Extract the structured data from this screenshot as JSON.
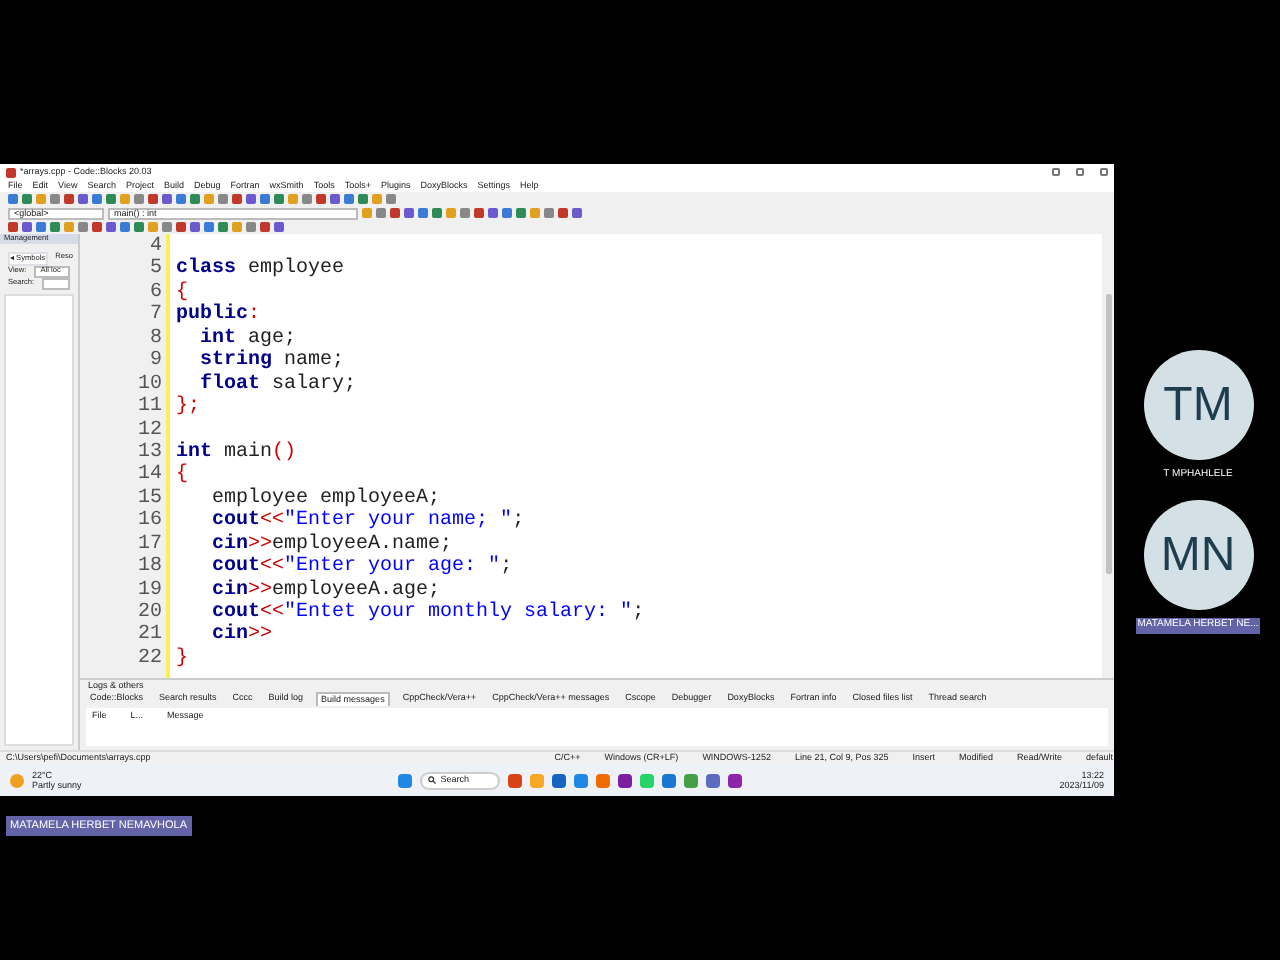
{
  "window": {
    "title": "*arrays.cpp - Code::Blocks 20.03"
  },
  "menu": [
    "File",
    "Edit",
    "View",
    "Search",
    "Project",
    "Build",
    "Debug",
    "Fortran",
    "wxSmith",
    "Tools",
    "Tools+",
    "Plugins",
    "DoxyBlocks",
    "Settings",
    "Help"
  ],
  "scope": {
    "scope_field": "<global>",
    "function_field": "main() : int"
  },
  "management": {
    "title": "Management",
    "tabs": [
      {
        "label": "◂ Symbols",
        "selected": true
      },
      {
        "label": "Reso",
        "selected": false
      }
    ],
    "view_label": "View:",
    "view_value": "All loc",
    "search_label": "Search:"
  },
  "editor": {
    "lines": [
      {
        "number": "4"
      },
      {
        "number": "5",
        "tokens": [
          {
            "kind": "keyword",
            "text": "class"
          },
          {
            "kind": "plain",
            "text": " employee"
          }
        ]
      },
      {
        "number": "6",
        "tokens": [
          {
            "kind": "op",
            "text": "{"
          }
        ]
      },
      {
        "number": "7",
        "tokens": [
          {
            "kind": "keyword",
            "text": "public"
          },
          {
            "kind": "op",
            "text": ":"
          }
        ]
      },
      {
        "number": "8",
        "tokens": [
          {
            "kind": "keyword",
            "text": "  int"
          },
          {
            "kind": "plain",
            "text": " age;"
          }
        ]
      },
      {
        "number": "9",
        "tokens": [
          {
            "kind": "keyword",
            "text": "  string"
          },
          {
            "kind": "plain",
            "text": " name;"
          }
        ]
      },
      {
        "number": "10",
        "tokens": [
          {
            "kind": "keyword",
            "text": "  float"
          },
          {
            "kind": "plain",
            "text": " salary;"
          }
        ]
      },
      {
        "number": "11",
        "tokens": [
          {
            "kind": "op",
            "text": "};"
          }
        ]
      },
      {
        "number": "12"
      },
      {
        "number": "13",
        "tokens": [
          {
            "kind": "keyword",
            "text": "int"
          },
          {
            "kind": "plain",
            "text": " main"
          },
          {
            "kind": "op",
            "text": "()"
          }
        ]
      },
      {
        "number": "14",
        "tokens": [
          {
            "kind": "op",
            "text": "{"
          }
        ]
      },
      {
        "number": "15",
        "tokens": [
          {
            "kind": "plain",
            "text": "   employee employeeA;"
          }
        ]
      },
      {
        "number": "16",
        "tokens": [
          {
            "kind": "keyword",
            "text": "   cout"
          },
          {
            "kind": "op",
            "text": "<<"
          },
          {
            "kind": "string",
            "text": "\"Enter your name; \""
          },
          {
            "kind": "plain",
            "text": ";"
          }
        ]
      },
      {
        "number": "17",
        "tokens": [
          {
            "kind": "keyword",
            "text": "   cin"
          },
          {
            "kind": "op",
            "text": ">>"
          },
          {
            "kind": "plain",
            "text": "employeeA.name;"
          }
        ]
      },
      {
        "number": "18",
        "tokens": [
          {
            "kind": "keyword",
            "text": "   cout"
          },
          {
            "kind": "op",
            "text": "<<"
          },
          {
            "kind": "string",
            "text": "\"Enter your age: \""
          },
          {
            "kind": "plain",
            "text": ";"
          }
        ]
      },
      {
        "number": "19",
        "tokens": [
          {
            "kind": "keyword",
            "text": "   cin"
          },
          {
            "kind": "op",
            "text": ">>"
          },
          {
            "kind": "plain",
            "text": "employeeA.age;"
          }
        ]
      },
      {
        "number": "20",
        "tokens": [
          {
            "kind": "keyword",
            "text": "   cout"
          },
          {
            "kind": "op",
            "text": "<<"
          },
          {
            "kind": "string",
            "text": "\"Entet your monthly salary: \""
          },
          {
            "kind": "plain",
            "text": ";"
          }
        ]
      },
      {
        "number": "21",
        "tokens": [
          {
            "kind": "keyword",
            "text": "   cin"
          },
          {
            "kind": "op",
            "text": ">>"
          }
        ]
      },
      {
        "number": "22",
        "tokens": [
          {
            "kind": "op",
            "text": "}"
          }
        ]
      }
    ]
  },
  "logs": {
    "title": "Logs & others",
    "tabs": [
      {
        "label": "Code::Blocks",
        "selected": false
      },
      {
        "label": "Search results",
        "selected": false
      },
      {
        "label": "Cccc",
        "selected": false
      },
      {
        "label": "Build log",
        "selected": false
      },
      {
        "label": "Build messages",
        "selected": true
      },
      {
        "label": "CppCheck/Vera++",
        "selected": false
      },
      {
        "label": "CppCheck/Vera++ messages",
        "selected": false
      },
      {
        "label": "Cscope",
        "selected": false
      },
      {
        "label": "Debugger",
        "selected": false
      },
      {
        "label": "DoxyBlocks",
        "selected": false
      },
      {
        "label": "Fortran info",
        "selected": false
      },
      {
        "label": "Closed files list",
        "selected": false
      },
      {
        "label": "Thread search",
        "selected": false
      }
    ],
    "columns": [
      "File",
      "L...",
      "Message"
    ]
  },
  "status_bar": {
    "path": "C:\\Users\\pefi\\Documents\\arrays.cpp",
    "items": [
      "C/C++",
      "Windows (CR+LF)",
      "WINDOWS-1252",
      "Line 21, Col 9, Pos 325",
      "Insert",
      "Modified",
      "Read/Write",
      "default"
    ]
  },
  "taskbar": {
    "temperature": "22°C",
    "weather": "Partly sunny",
    "search_placeholder": "Search",
    "time": "13:22",
    "date": "2023/11/09"
  },
  "participants": [
    {
      "initials": "TM",
      "name": "T MPHAHLELE",
      "selected": false
    },
    {
      "initials": "MN",
      "name": "MATAMELA HERBET NE...",
      "selected": true
    }
  ],
  "presenter": {
    "name": "MATAMELA HERBET NEMAVHOLA"
  }
}
